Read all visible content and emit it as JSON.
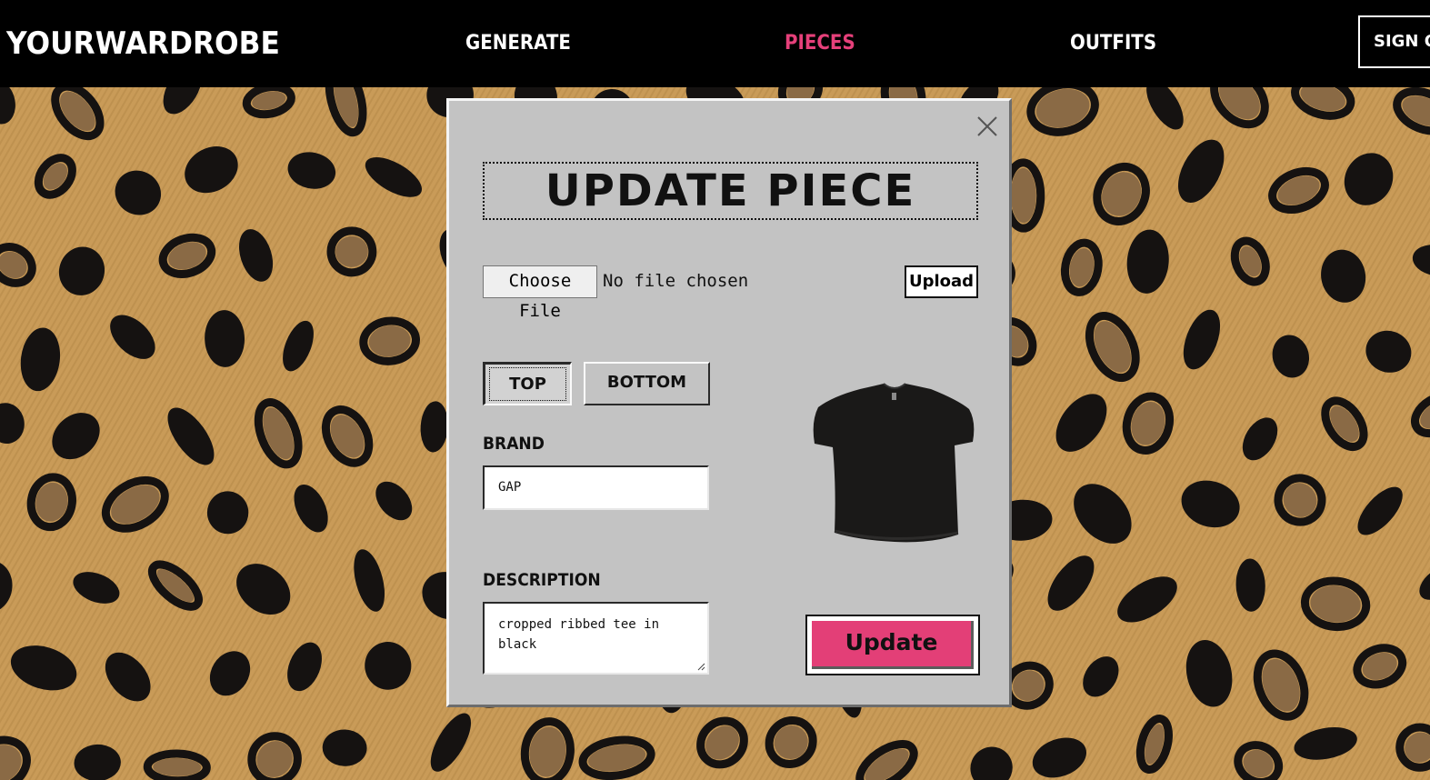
{
  "header": {
    "logo": "YOURWARDROBE",
    "nav": [
      {
        "label": "GENERATE",
        "active": false
      },
      {
        "label": "PIECES",
        "active": true
      },
      {
        "label": "OUTFITS",
        "active": false
      }
    ],
    "signout_label": "SIGN OUT"
  },
  "modal": {
    "title": "UPDATE PIECE",
    "file": {
      "choose_label": "Choose File",
      "status": "No file chosen",
      "upload_label": "Upload"
    },
    "type_options": [
      {
        "label": "TOP",
        "selected": true
      },
      {
        "label": "BOTTOM",
        "selected": false
      }
    ],
    "brand": {
      "label": "BRAND",
      "value": "GAP"
    },
    "description": {
      "label": "DESCRIPTION",
      "value": "cropped ribbed tee in black"
    },
    "submit_label": "Update",
    "preview_image": "black-cropped-tee"
  },
  "colors": {
    "header_bg": "#000000",
    "nav_active": "#e6407a",
    "modal_bg": "#c3c3c3",
    "update_button": "#e33f77",
    "leopard_base": "#c79a57",
    "leopard_spot": "#141110"
  },
  "icons": {
    "close": "close-icon",
    "background": "leopard-print-pattern"
  }
}
